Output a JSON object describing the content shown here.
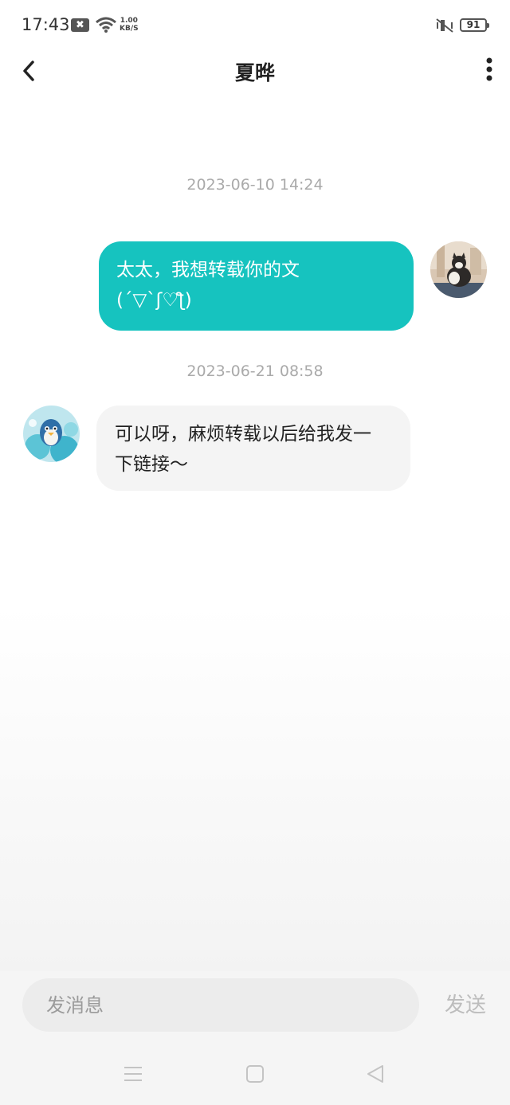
{
  "status_bar": {
    "time": "17:43",
    "net_speed_value": "1.00",
    "net_speed_unit": "KB/S",
    "battery": "91"
  },
  "header": {
    "title": "夏晔"
  },
  "messages": [
    {
      "timestamp": "2023-06-10 14:24",
      "direction": "sent",
      "lines": [
        "太太，我想转载你的文",
        "(´▽`ʃ♡ƪ)"
      ]
    },
    {
      "timestamp": "2023-06-21 08:58",
      "direction": "received",
      "lines": [
        "可以呀，麻烦转载以后给我发一",
        "下链接～"
      ]
    }
  ],
  "composer": {
    "placeholder": "发消息",
    "send_label": "发送"
  },
  "colors": {
    "sent_bubble": "#16c3bf",
    "received_bubble": "#f4f4f4",
    "timestamp": "#aaaaaa"
  }
}
